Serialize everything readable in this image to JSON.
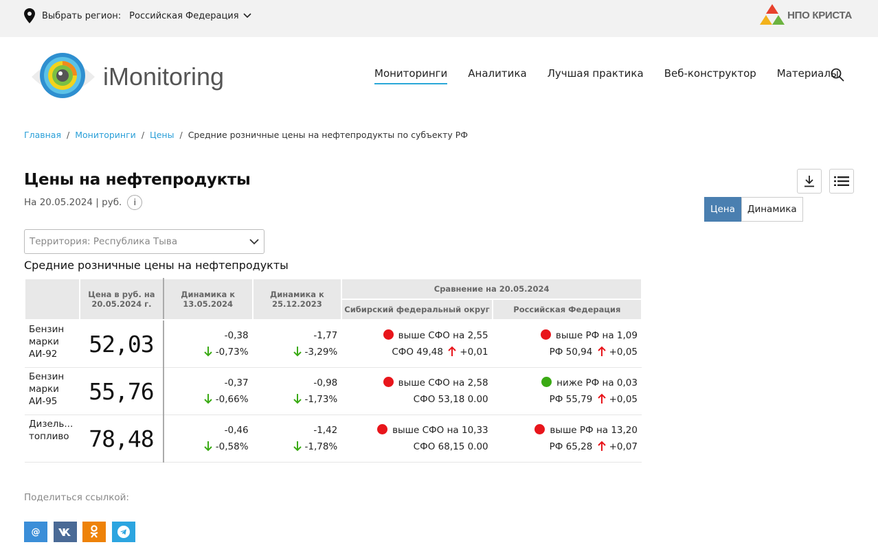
{
  "topbar": {
    "region_label": "Выбрать регион:",
    "region_value": "Российская Федерация",
    "brand": "НПО КРИСТА"
  },
  "logo": {
    "name": "iMonitoring"
  },
  "nav": [
    {
      "label": "Мониторинги",
      "active": true
    },
    {
      "label": "Аналитика"
    },
    {
      "label": "Лучшая практика"
    },
    {
      "label": "Веб-конструктор"
    },
    {
      "label": "Материалы"
    }
  ],
  "breadcrumb": {
    "items": [
      "Главная",
      "Мониторинги",
      "Цены"
    ],
    "current": "Средние розничные цены на нефтепродукты по субъекту РФ"
  },
  "page": {
    "title": "Цены на нефтепродукты",
    "subtitle": "На 20.05.2024 | руб.",
    "info": "i"
  },
  "toggle": {
    "price": "Цена",
    "dynamics": "Динамика"
  },
  "filter": {
    "value": "Территория: Республика Тыва"
  },
  "table": {
    "title": "Средние розничные цены на нефтепродукты",
    "headers": {
      "price": "Цена в руб. на 20.05.2024 г.",
      "dyn1": "Динамика к 13.05.2024",
      "dyn2": "Динамика к 25.12.2023",
      "compare": "Сравнение на 20.05.2024",
      "sfo": "Сибирский федеральный округ",
      "rf": "Российская Федерация"
    },
    "rows": [
      {
        "name": "Бензин марки АИ-92",
        "price": "52,03",
        "d1_abs": "-0,38",
        "d1_pct": "-0,73%",
        "d2_abs": "-1,77",
        "d2_pct": "-3,29%",
        "sfo_text": "выше СФО на 2,55",
        "sfo_val": "СФО 49,48",
        "sfo_delta": "+0,01",
        "sfo_dot": "#e8151b",
        "rf_text": "выше РФ на 1,09",
        "rf_val": "РФ 50,94",
        "rf_delta": "+0,05",
        "rf_dot": "#e8151b"
      },
      {
        "name": "Бензин марки АИ-95",
        "price": "55,76",
        "d1_abs": "-0,37",
        "d1_pct": "-0,66%",
        "d2_abs": "-0,98",
        "d2_pct": "-1,73%",
        "sfo_text": "выше СФО на 2,58",
        "sfo_val": "СФО 53,18 0.00",
        "sfo_delta": "",
        "sfo_dot": "#e8151b",
        "rf_text": "ниже РФ на 0,03",
        "rf_val": "РФ 55,79",
        "rf_delta": "+0,05",
        "rf_dot": "#3aaa14"
      },
      {
        "name": "Дизель... топливо",
        "price": "78,48",
        "d1_abs": "-0,46",
        "d1_pct": "-0,58%",
        "d2_abs": "-1,42",
        "d2_pct": "-1,78%",
        "sfo_text": "выше СФО на 10,33",
        "sfo_val": "СФО 68,15 0.00",
        "sfo_delta": "",
        "sfo_dot": "#e8151b",
        "rf_text": "выше РФ на 13,20",
        "rf_val": "РФ 65,28",
        "rf_delta": "+0,07",
        "rf_dot": "#e8151b"
      }
    ]
  },
  "share": {
    "label": "Поделиться ссылкой:",
    "mail": "@",
    "vk": "VK",
    "ok": "ok",
    "tg": "tg"
  },
  "colors": {
    "accent": "#2aa7d8",
    "toggle_on": "#4a7fb0",
    "down_arrow": "#3aaa14",
    "up_arrow": "#e8151b"
  }
}
